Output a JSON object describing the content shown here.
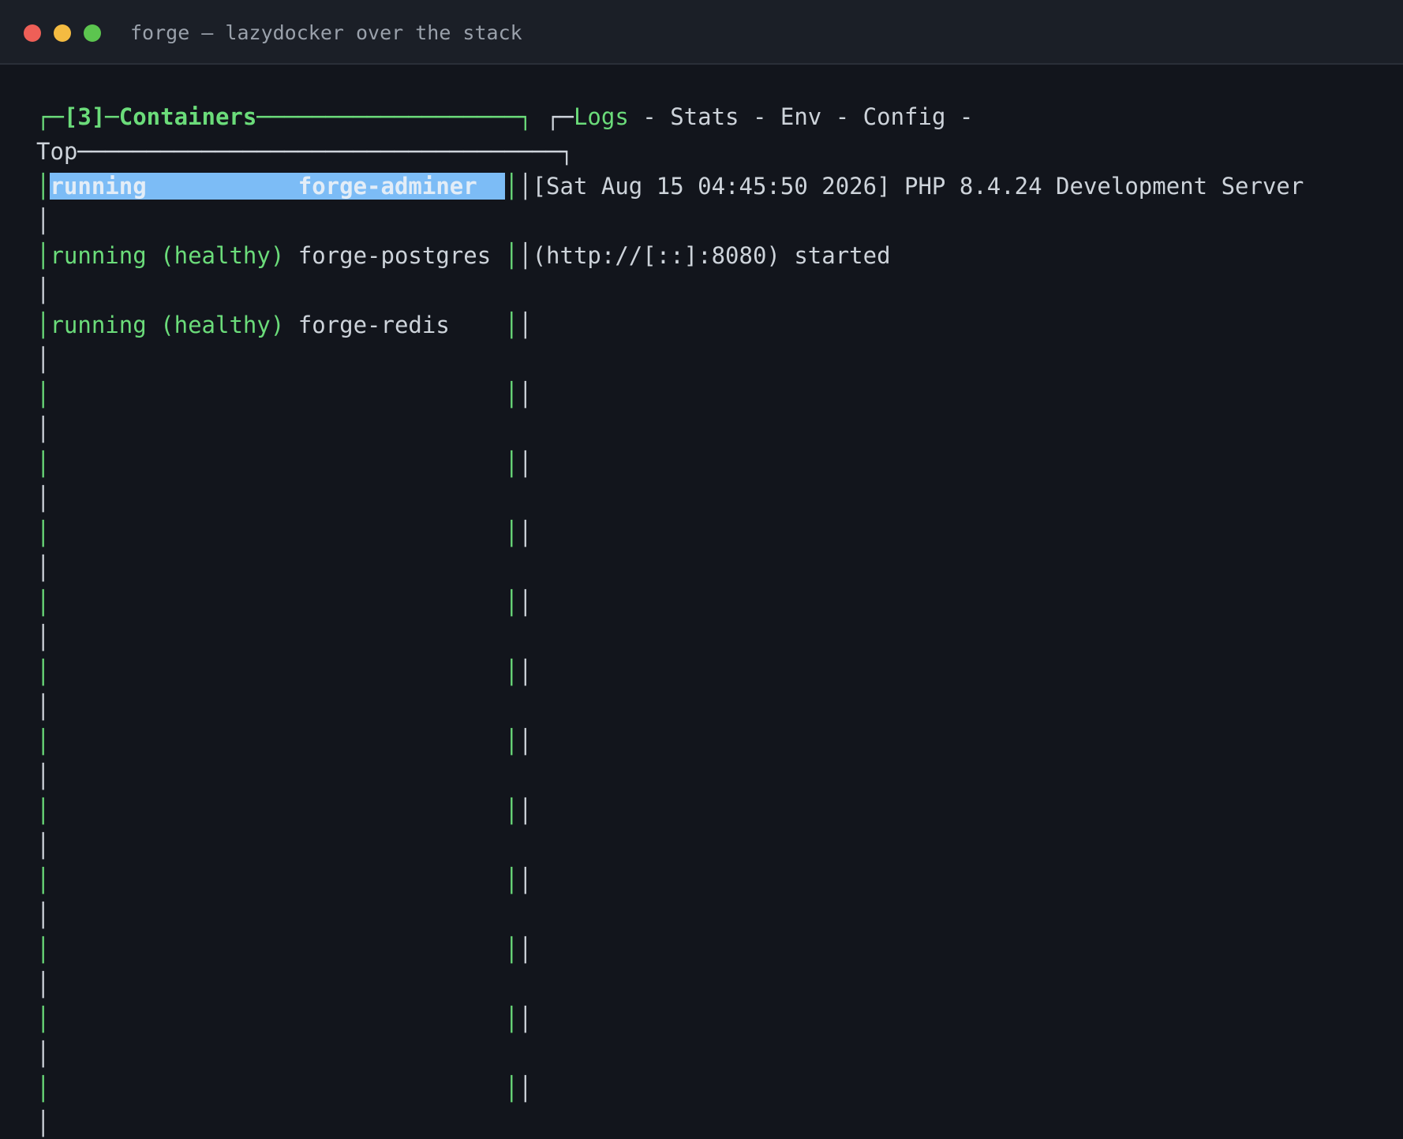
{
  "window": {
    "title": "forge — lazydocker over the stack",
    "controls": {
      "close_color": "#ee5f57",
      "minimize_color": "#f4bb41",
      "zoom_color": "#5cc54f"
    }
  },
  "containers_panel": {
    "title": "[3]─Containers",
    "top_label": "Top",
    "rows": [
      {
        "status": "running",
        "name": "forge-adminer",
        "selected": true
      },
      {
        "status": "running (healthy)",
        "name": "forge-postgres",
        "selected": false
      },
      {
        "status": "running (healthy)",
        "name": "forge-redis",
        "selected": false
      }
    ]
  },
  "detail_panel": {
    "tabs": [
      {
        "label": "Logs",
        "active": true
      },
      {
        "label": "Stats",
        "active": false
      },
      {
        "label": "Env",
        "active": false
      },
      {
        "label": "Config",
        "active": false
      }
    ],
    "log_lines": [
      "[Sat Aug 15 04:45:50 2026] PHP 8.4.24 Development Server",
      "(http://[::]:8080) started"
    ]
  },
  "colors": {
    "accent_green": "#6bdc7a",
    "selection_bg": "#7cbcf6",
    "background": "#12151c",
    "titlebar_bg": "#1b1f27"
  }
}
